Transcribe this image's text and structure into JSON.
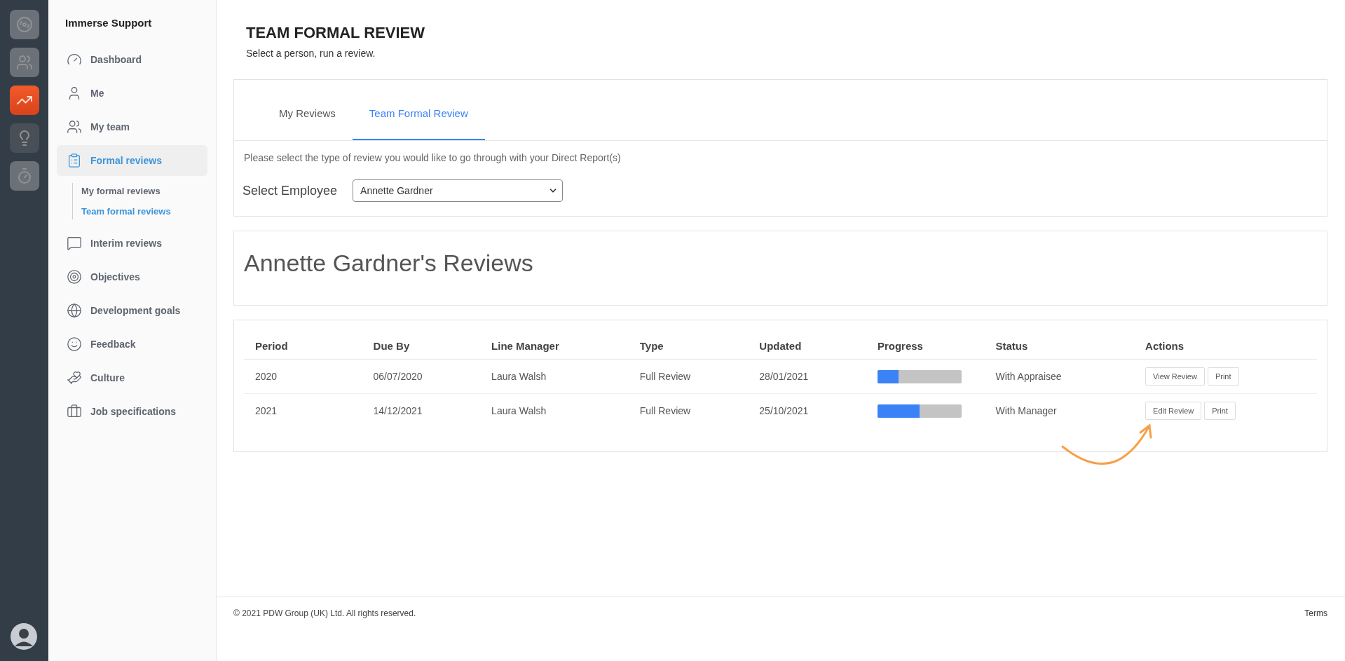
{
  "rail": {
    "apps": [
      {
        "kind": "spiral",
        "selected": false
      },
      {
        "kind": "people",
        "selected": false
      },
      {
        "kind": "chart",
        "selected": true
      },
      {
        "kind": "bulb",
        "selected": false
      },
      {
        "kind": "stopwatch",
        "selected": false
      }
    ]
  },
  "sidebar": {
    "title": "Immerse Support",
    "items": [
      {
        "label": "Dashboard",
        "kind": "gauge",
        "selected": false
      },
      {
        "label": "Me",
        "kind": "user",
        "selected": false
      },
      {
        "label": "My team",
        "kind": "users",
        "selected": false
      },
      {
        "label": "Formal reviews",
        "kind": "clipboard",
        "selected": true,
        "expanded": true,
        "children": [
          {
            "label": "My formal reviews",
            "selected": false
          },
          {
            "label": "Team formal reviews",
            "selected": true
          }
        ]
      },
      {
        "label": "Interim reviews",
        "kind": "chat",
        "selected": false
      },
      {
        "label": "Objectives",
        "kind": "target",
        "selected": false
      },
      {
        "label": "Development goals",
        "kind": "ball",
        "selected": false
      },
      {
        "label": "Feedback",
        "kind": "smile",
        "selected": false
      },
      {
        "label": "Culture",
        "kind": "hands",
        "selected": false
      },
      {
        "label": "Job specifications",
        "kind": "briefcase",
        "selected": false
      }
    ]
  },
  "page": {
    "title": "TEAM FORMAL REVIEW",
    "subtitle": "Select a person, run a review."
  },
  "tabs": [
    {
      "label": "My Reviews",
      "selected": false
    },
    {
      "label": "Team Formal Review",
      "selected": true
    }
  ],
  "instructions": "Please select the type of review you would like to go through with your Direct Report(s)",
  "employee_select": {
    "label": "Select Employee",
    "value": "Annette Gardner"
  },
  "reviews_heading": "Annette Gardner's Reviews",
  "table": {
    "columns": [
      "Period",
      "Due By",
      "Line Manager",
      "Type",
      "Updated",
      "Progress",
      "Status",
      "Actions"
    ],
    "rows": [
      {
        "period": "2020",
        "due_by": "06/07/2020",
        "line_manager": "Laura Walsh",
        "type": "Full Review",
        "updated": "28/01/2021",
        "progress": {
          "level": 0.25
        },
        "status": "With Appraisee",
        "actions": [
          "View Review",
          "Print"
        ]
      },
      {
        "period": "2021",
        "due_by": "14/12/2021",
        "line_manager": "Laura Walsh",
        "type": "Full Review",
        "updated": "25/10/2021",
        "progress": {
          "level": 0.5
        },
        "status": "With Manager",
        "actions": [
          "Edit Review",
          "Print"
        ]
      }
    ]
  },
  "footer": {
    "copyright": "© 2021 PDW Group (UK) Ltd. All rights reserved.",
    "link": "Terms"
  }
}
